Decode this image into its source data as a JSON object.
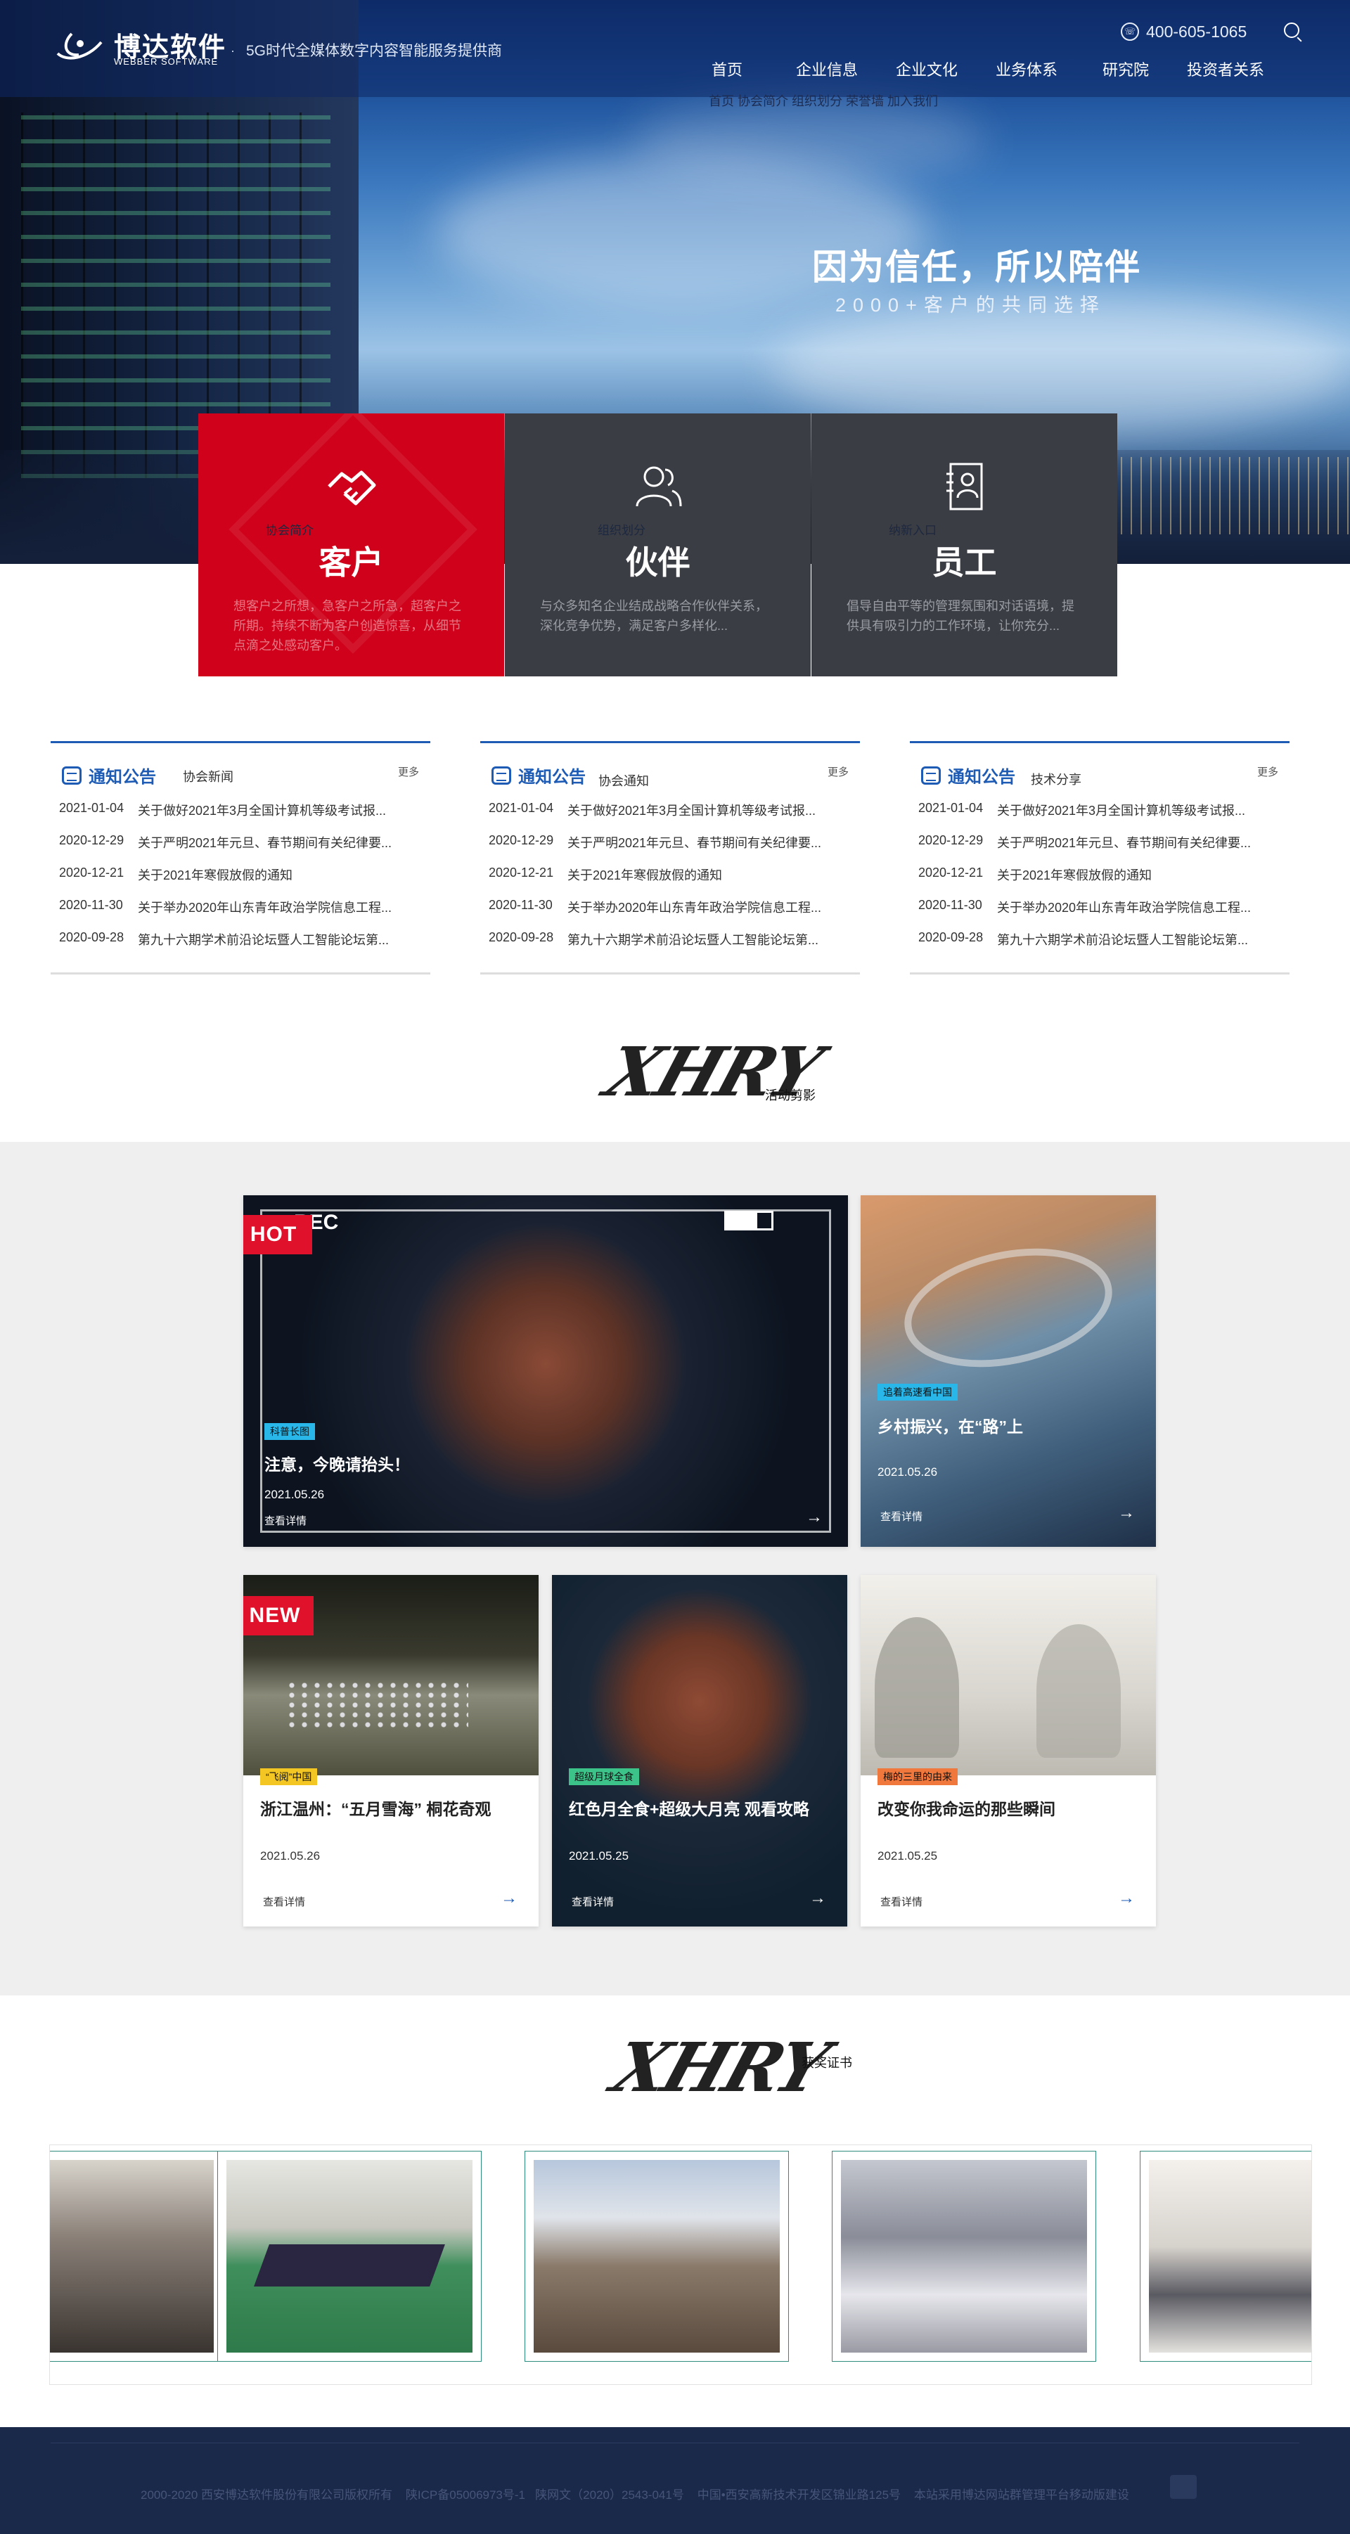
{
  "header": {
    "logo_cn": "博达软件",
    "logo_en": "WEBBER SOFTWARE",
    "separator": "·",
    "slogan": "5G时代全媒体数字内容智能服务提供商",
    "phone": "400-605-1065",
    "nav": [
      "首页",
      "企业信息",
      "企业文化",
      "业务体系",
      "研究院",
      "投资者关系"
    ],
    "subnav": "首页 协会简介 组织划分 荣誉墙 加入我们"
  },
  "hero": {
    "title": "因为信任，所以陪伴",
    "subtitle": "2000+客户的共同选择"
  },
  "cards": [
    {
      "small": "协会简介",
      "title": "客户",
      "desc": "想客户之所想，急客户之所急，超客户之所期。持续不断为客户创造惊喜，从细节点滴之处感动客户。",
      "bg": "#d0021b"
    },
    {
      "small": "组织划分",
      "title": "伙伴",
      "desc": "与众多知名企业结成战略合作伙伴关系，深化竞争优势，满足客户多样化...",
      "bg": "#3b3d44"
    },
    {
      "small": "纳新入口",
      "title": "员工",
      "desc": "倡导自由平等的管理氛围和对话语境，提供具有吸引力的工作环境，让你充分...",
      "bg": "#3b3d44"
    }
  ],
  "notices": [
    {
      "title": "通知公告",
      "tab": "协会新闻",
      "more": "更多",
      "items": [
        {
          "date": "2021-01-04",
          "text": "关于做好2021年3月全国计算机等级考试报..."
        },
        {
          "date": "2020-12-29",
          "text": "关于严明2021年元旦、春节期间有关纪律要..."
        },
        {
          "date": "2020-12-21",
          "text": "关于2021年寒假放假的通知"
        },
        {
          "date": "2020-11-30",
          "text": "关于举办2020年山东青年政治学院信息工程..."
        },
        {
          "date": "2020-09-28",
          "text": "第九十六期学术前沿论坛暨人工智能论坛第..."
        }
      ]
    },
    {
      "title": "通知公告",
      "tab": "协会通知",
      "more": "更多",
      "items": [
        {
          "date": "2021-01-04",
          "text": "关于做好2021年3月全国计算机等级考试报..."
        },
        {
          "date": "2020-12-29",
          "text": "关于严明2021年元旦、春节期间有关纪律要..."
        },
        {
          "date": "2020-12-21",
          "text": "关于2021年寒假放假的通知"
        },
        {
          "date": "2020-11-30",
          "text": "关于举办2020年山东青年政治学院信息工程..."
        },
        {
          "date": "2020-09-28",
          "text": "第九十六期学术前沿论坛暨人工智能论坛第..."
        }
      ]
    },
    {
      "title": "通知公告",
      "tab": "技术分享",
      "more": "更多",
      "items": [
        {
          "date": "2021-01-04",
          "text": "关于做好2021年3月全国计算机等级考试报..."
        },
        {
          "date": "2020-12-29",
          "text": "关于严明2021年元旦、春节期间有关纪律要..."
        },
        {
          "date": "2020-12-21",
          "text": "关于2021年寒假放假的通知"
        },
        {
          "date": "2020-11-30",
          "text": "关于举办2020年山东青年政治学院信息工程..."
        },
        {
          "date": "2020-09-28",
          "text": "第九十六期学术前沿论坛暨人工智能论坛第..."
        }
      ]
    }
  ],
  "activity": {
    "logo": "XHRY",
    "subtitle": "活动剪影",
    "hot": "HOT",
    "new": "NEW",
    "rec": "REC",
    "tiles": [
      {
        "tag": "科普长图",
        "title": "注意，今晚请抬头！",
        "date": "2021.05.26",
        "more": "查看详情",
        "tag_color": "#29b6e8"
      },
      {
        "tag": "追着高速看中国",
        "title": "乡村振兴，在“路”上",
        "date": "2021.05.26",
        "more": "查看详情",
        "tag_color": "#29b6e8"
      },
      {
        "tag": "“飞阅”中国",
        "title": "浙江温州：“五月雪海” 桐花奇观",
        "date": "2021.05.26",
        "more": "查看详情",
        "tag_color": "#f3c623"
      },
      {
        "tag": "超级月球全食",
        "title": "红色月全食+超级大月亮 观看攻略",
        "date": "2021.05.25",
        "more": "查看详情",
        "tag_color": "#3cc38a"
      },
      {
        "tag": "梅的三里的由来",
        "title": "改变你我命运的那些瞬间",
        "date": "2021.05.25",
        "more": "查看详情",
        "tag_color": "#f0783c"
      }
    ]
  },
  "awards": {
    "logo": "XHRY",
    "subtitle": "获奖证书"
  },
  "footer": {
    "text": "2000-2020 西安博达软件股份有限公司版权所有    陕ICP备05006973号-1   陕网文（2020）2543-041号    中国•西安高新技术开发区锦业路125号    本站采用博达网站群管理平台移动版建设"
  },
  "colors": {
    "accent_blue": "#1e5bb5",
    "brand_red": "#d0021b",
    "footer_bg": "#1a2849"
  }
}
